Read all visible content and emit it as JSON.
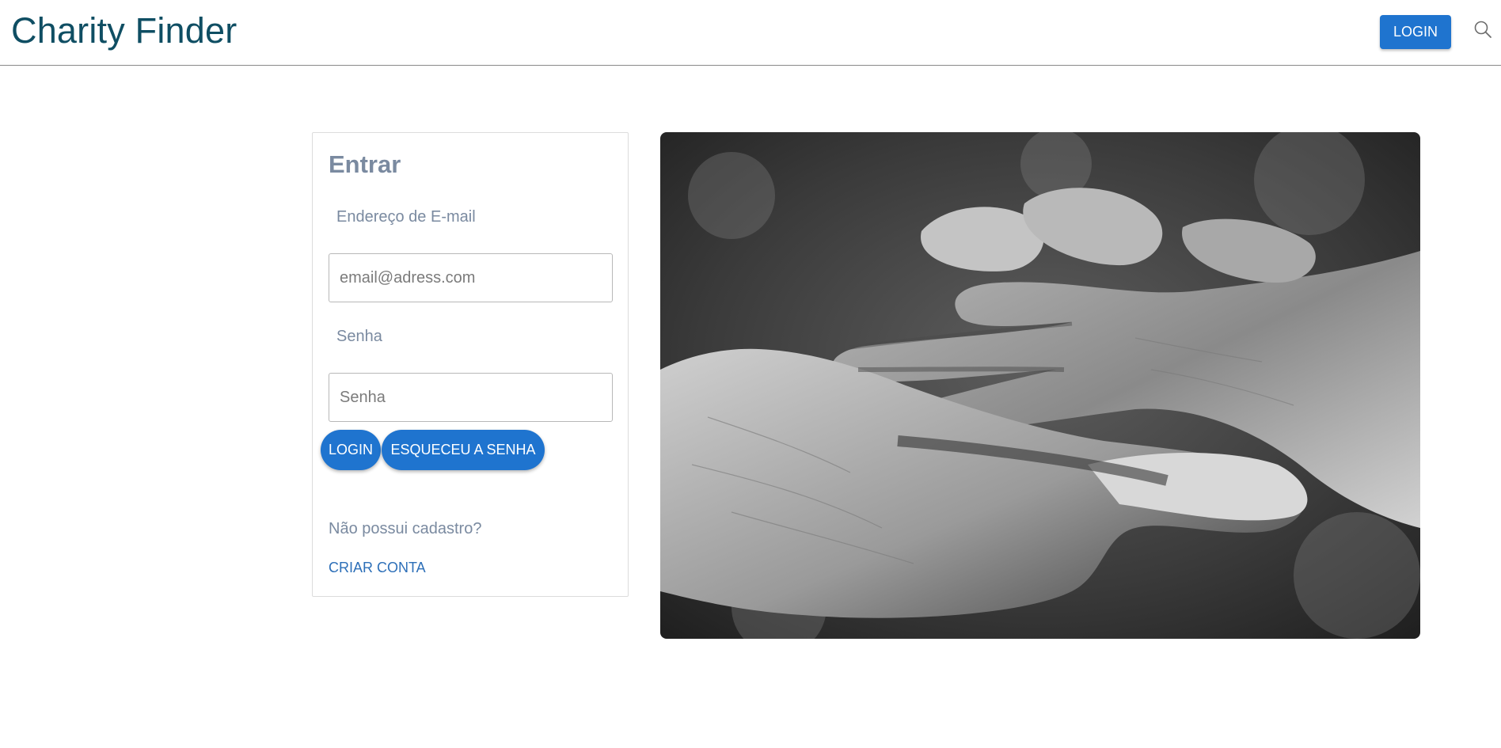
{
  "header": {
    "brand": "Charity Finder",
    "login_label": "LOGIN",
    "search_icon": "search-icon"
  },
  "login_card": {
    "title": "Entrar",
    "email_label": "Endereço de E-mail",
    "email_placeholder": "email@adress.com",
    "email_value": "",
    "password_label": "Senha",
    "password_placeholder": "Senha",
    "password_value": "",
    "login_button": "LOGIN",
    "forgot_button": "ESQUECEU A SENHA",
    "no_account_text": "Não possui cadastro?",
    "create_account_link": "CRIAR CONTA"
  },
  "hero_image": {
    "subject": "black-and-white photo of two hands clasped",
    "style": "grayscale"
  },
  "colors": {
    "brand": "#0f4e63",
    "primary": "#1f74cf",
    "muted_text": "#7a8aa0",
    "link": "#2d6fb8"
  }
}
